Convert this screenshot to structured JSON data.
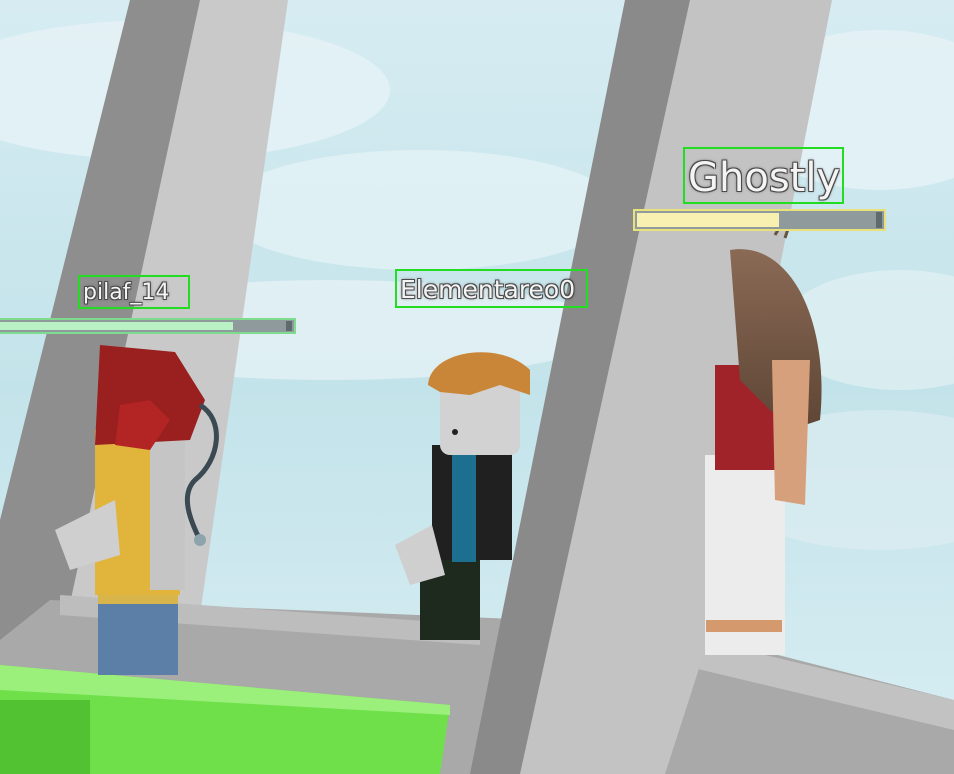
{
  "game": {
    "players": [
      {
        "name": "pilaf_14",
        "health": 0.8,
        "bar_color": "#7fdc8f",
        "fill_color": "#b9f0c4"
      },
      {
        "name": "Elementareo0",
        "health": null
      },
      {
        "name": "Ghostly",
        "health": 0.58,
        "bar_color": "#e9e27a",
        "fill_color": "#f7f0b0"
      }
    ],
    "highlight_color": "#22dd22"
  }
}
